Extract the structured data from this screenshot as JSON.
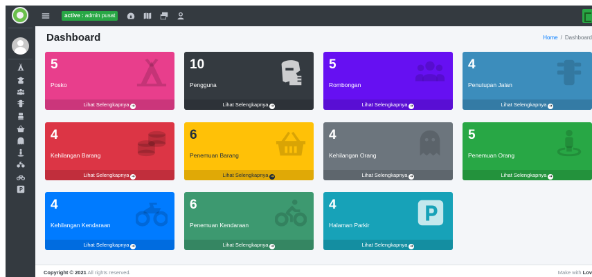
{
  "topbar": {
    "menu_icon": "bars-icon",
    "active_prefix": "active :",
    "active_user": "admin pusat",
    "icons": [
      "dashboard-icon",
      "map-icon",
      "windows-icon",
      "user-icon"
    ]
  },
  "sidebar": {
    "items": [
      "campground-icon",
      "user-secret-icon",
      "users-icon",
      "traffic-light-icon",
      "box-icon",
      "shopping-basket-icon",
      "ghost-icon",
      "street-view-icon",
      "motorcycle-icon",
      "bicycle-icon",
      "parking-icon"
    ]
  },
  "page": {
    "title": "Dashboard",
    "breadcrumb_home": "Home",
    "breadcrumb_sep": "/",
    "breadcrumb_current": "Dashboard"
  },
  "boxes": [
    {
      "number": "5",
      "label": "Posko",
      "footer": "Lihat Selengkapnya",
      "color": "#e83e8c",
      "icon": "campground-icon"
    },
    {
      "number": "10",
      "label": "Pengguna",
      "footer": "Lihat Selengkapnya",
      "color": "#343a40",
      "icon": "user-secret-icon"
    },
    {
      "number": "5",
      "label": "Rombongan",
      "footer": "Lihat Selengkapnya",
      "color": "#6610f2",
      "icon": "users-icon"
    },
    {
      "number": "4",
      "label": "Penutupan Jalan",
      "footer": "Lihat Selengkapnya",
      "color": "#3c8dbc",
      "icon": "traffic-light-icon"
    },
    {
      "number": "4",
      "label": "Kehilangan Barang",
      "footer": "Lihat Selengkapnya",
      "color": "#dc3545",
      "icon": "coins-icon"
    },
    {
      "number": "6",
      "label": "Penemuan Barang",
      "footer": "Lihat Selengkapnya",
      "color": "#ffc107",
      "icon": "shopping-basket-icon"
    },
    {
      "number": "4",
      "label": "Kehilangan Orang",
      "footer": "Lihat Selengkapnya",
      "color": "#6c757d",
      "icon": "ghost-icon"
    },
    {
      "number": "5",
      "label": "Penemuan Orang",
      "footer": "Lihat Selengkapnya",
      "color": "#28a745",
      "icon": "street-view-icon"
    },
    {
      "number": "4",
      "label": "Kehilangan Kendaraan",
      "footer": "Lihat Selengkapnya",
      "color": "#007bff",
      "icon": "motorcycle-icon"
    },
    {
      "number": "6",
      "label": "Penemuan Kendaraan",
      "footer": "Lihat Selengkapnya",
      "color": "#3d9970",
      "icon": "biking-icon"
    },
    {
      "number": "4",
      "label": "Halaman Parkir",
      "footer": "Lihat Selengkapnya",
      "color": "#17a2b8",
      "icon": "parking-icon"
    }
  ],
  "footer": {
    "copyright_prefix": "Copyright © 2021",
    "copyright_suffix": "All rights reserved.",
    "made_with": "Make with",
    "love": "Lov"
  }
}
